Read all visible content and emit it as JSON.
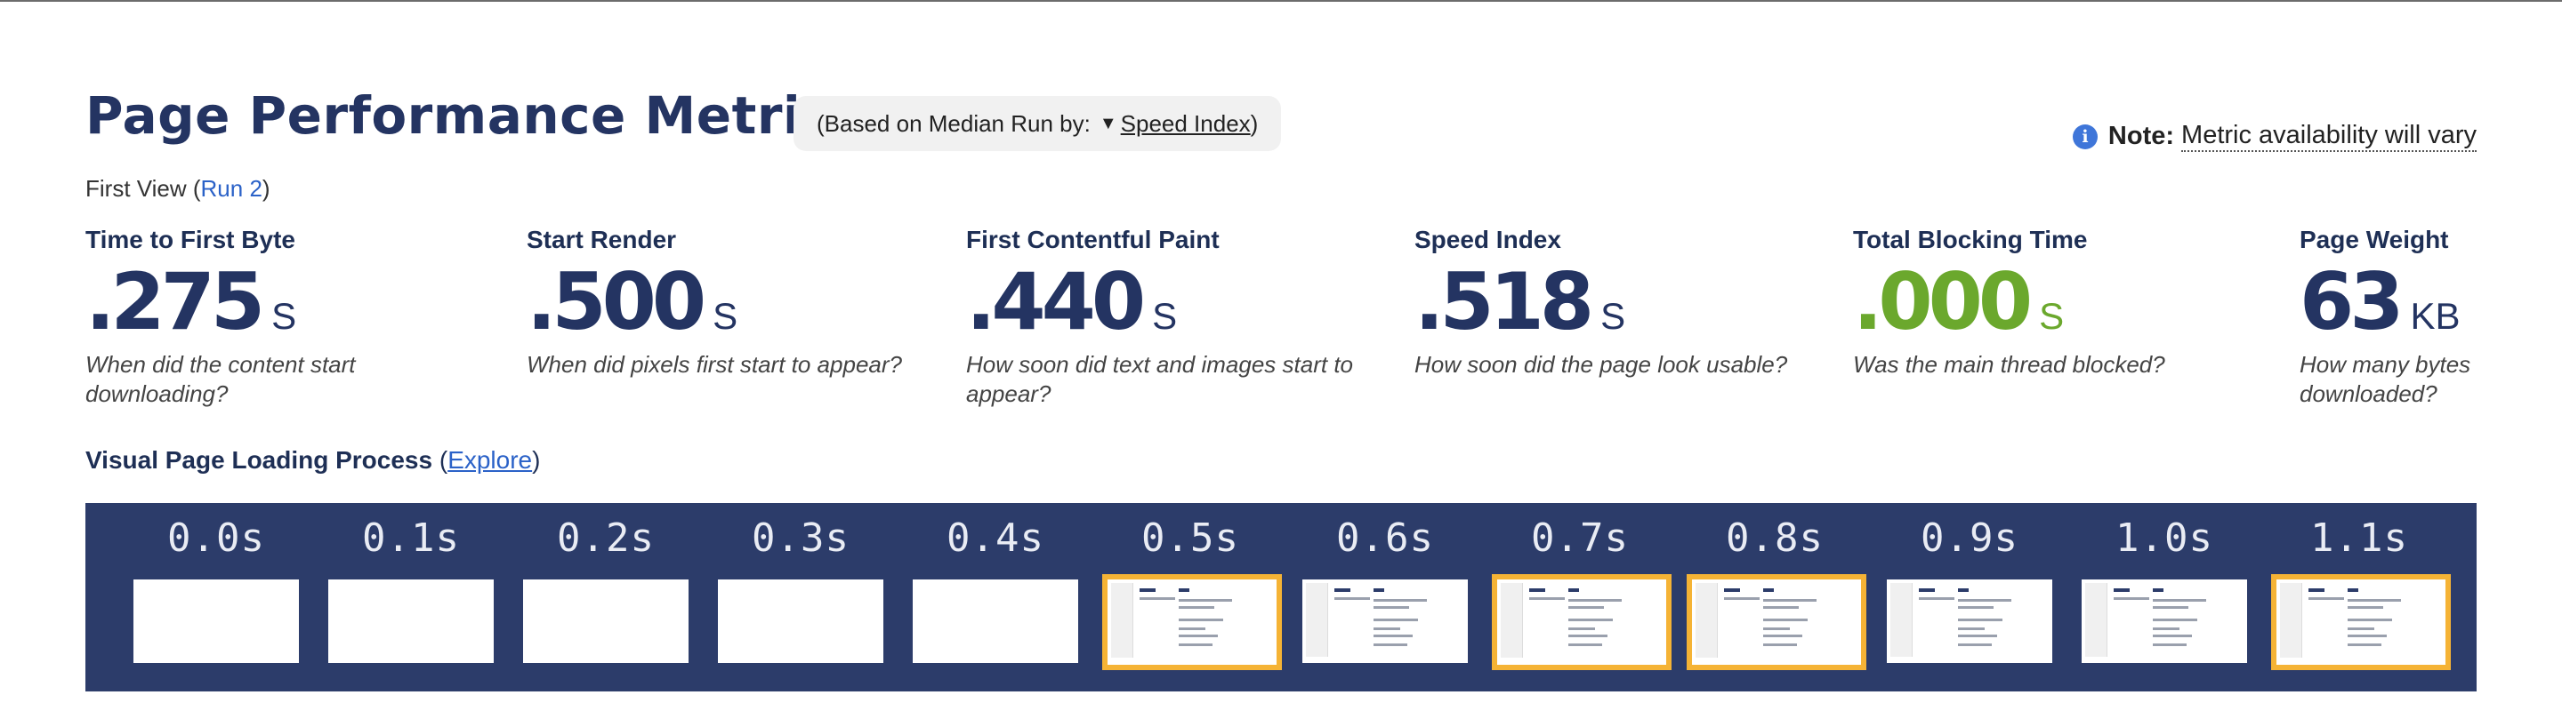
{
  "header": {
    "title": "Page Performance Metrics",
    "median_prefix": "(Based on Median Run by:",
    "median_link": "Speed Index",
    "median_suffix": ")",
    "note_bold": "Note:",
    "note_text": "Metric availability will vary"
  },
  "view": {
    "prefix": "First View (",
    "run_link": "Run 2",
    "suffix": ")"
  },
  "metrics": [
    {
      "label": "Time to First Byte",
      "value": ".275",
      "unit": "S",
      "desc": "When did the content start downloading?",
      "color": "#243462"
    },
    {
      "label": "Start Render",
      "value": ".500",
      "unit": "S",
      "desc": "When did pixels first start to appear?",
      "color": "#243462"
    },
    {
      "label": "First Contentful Paint",
      "value": ".440",
      "unit": "S",
      "desc": "How soon did text and images start to appear?",
      "color": "#243462"
    },
    {
      "label": "Speed Index",
      "value": ".518",
      "unit": "S",
      "desc": "How soon did the page look usable?",
      "color": "#243462"
    },
    {
      "label": "Total Blocking Time",
      "value": ".000",
      "unit": "S",
      "desc": "Was the main thread blocked?",
      "color": "#6ba82d"
    },
    {
      "label": "Page Weight",
      "value": "63",
      "unit": "KB",
      "desc": "How many bytes downloaded?",
      "color": "#243462"
    }
  ],
  "visual": {
    "title": "Visual Page Loading Process",
    "open": "(",
    "explore": "Explore",
    "close": ")"
  },
  "filmstrip": {
    "frames": [
      {
        "time": "0.0s",
        "state": "blank"
      },
      {
        "time": "0.1s",
        "state": "blank"
      },
      {
        "time": "0.2s",
        "state": "blank"
      },
      {
        "time": "0.3s",
        "state": "blank"
      },
      {
        "time": "0.4s",
        "state": "blank"
      },
      {
        "time": "0.5s",
        "state": "changed"
      },
      {
        "time": "0.6s",
        "state": "rendered"
      },
      {
        "time": "0.7s",
        "state": "changed"
      },
      {
        "time": "0.8s",
        "state": "changed"
      },
      {
        "time": "0.9s",
        "state": "rendered"
      },
      {
        "time": "1.0s",
        "state": "rendered"
      },
      {
        "time": "1.1s",
        "state": "changed"
      }
    ],
    "background_color": "#2c3c6a",
    "highlight_color": "#f5b335"
  },
  "icons": {
    "info": "info-icon",
    "dropdown": "triangle-down-icon"
  }
}
